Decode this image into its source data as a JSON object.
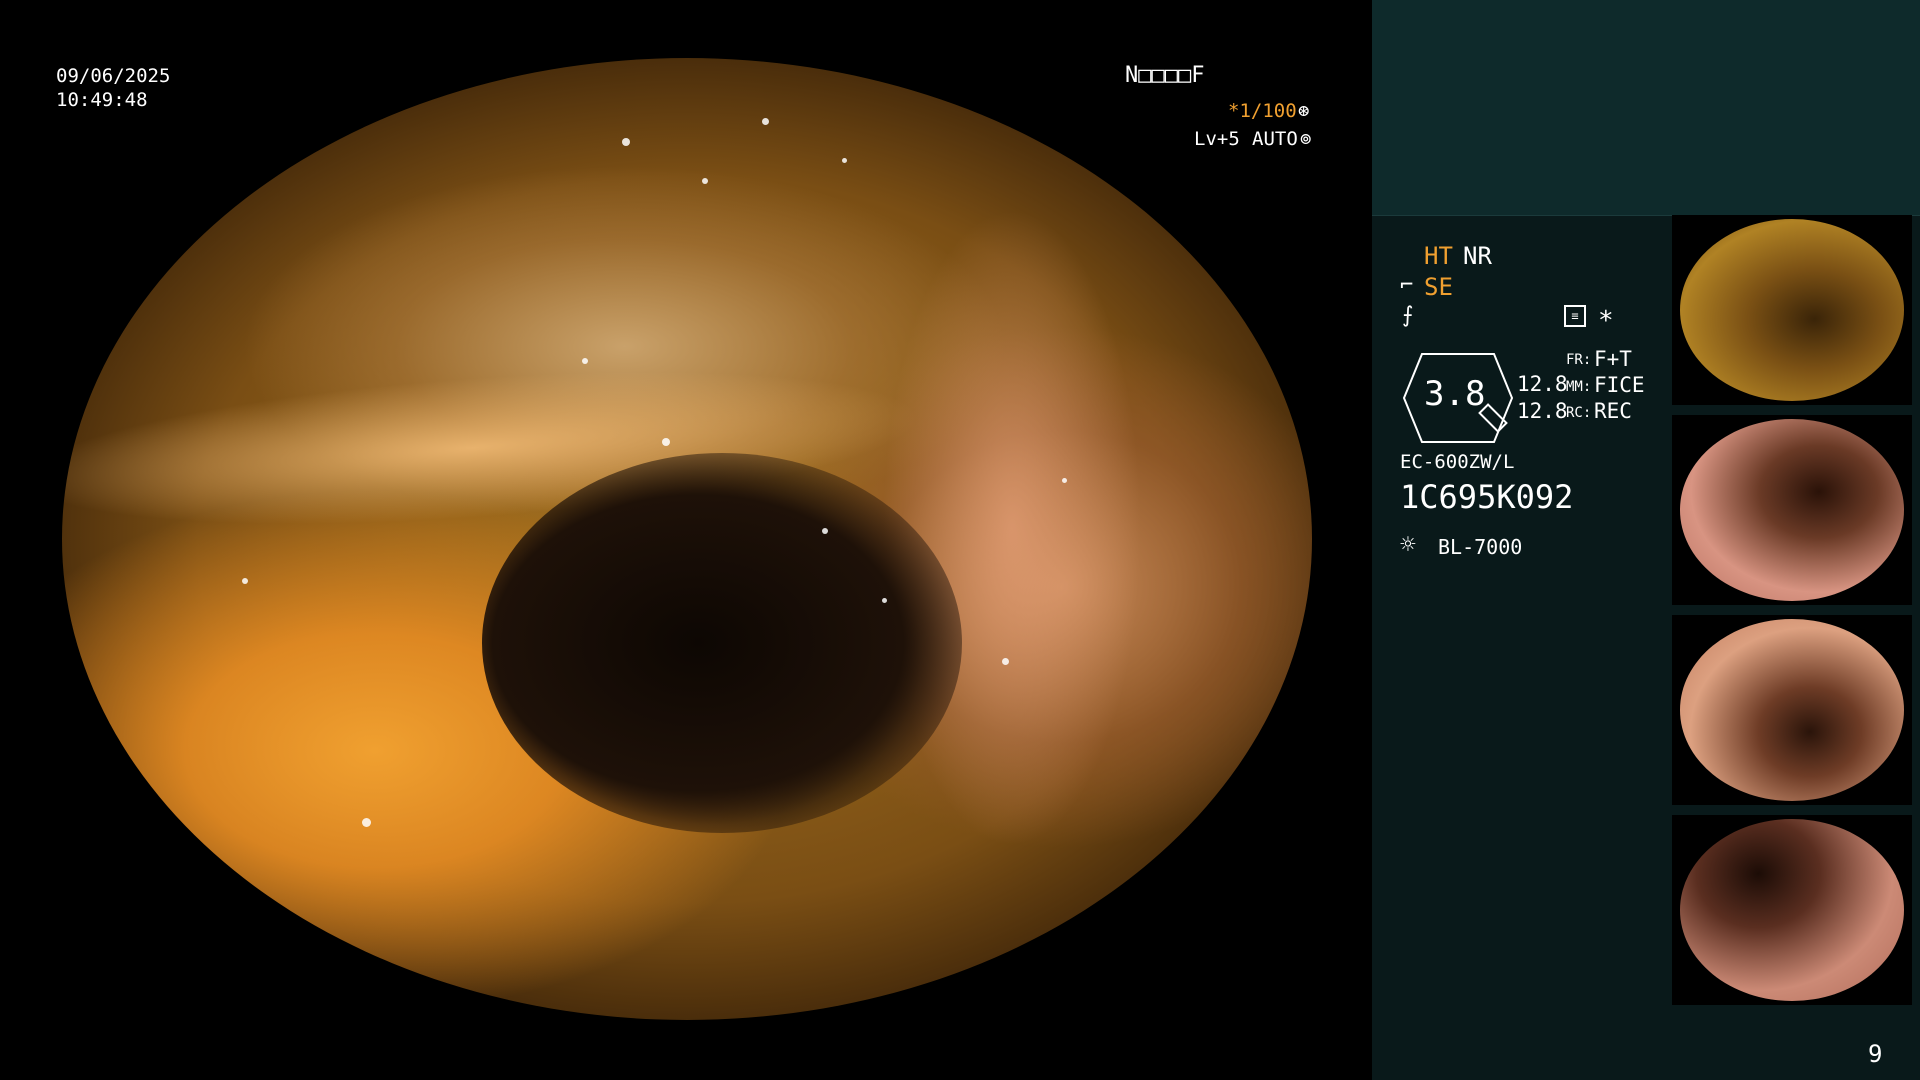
{
  "overlay": {
    "date": "09/06/2025",
    "time": "10:49:48",
    "patient_code": "N□□□□F",
    "shutter": "*1/100",
    "shutter_icon": "aperture-icon",
    "level": "Lv+5",
    "mode": "AUTO",
    "mode_icon": "iris-icon"
  },
  "status": {
    "ht": "HT",
    "nr": "NR",
    "se": "SE",
    "zoom": "3.8",
    "val1": "12.8",
    "val2": "12.8",
    "fr_label": "FR:",
    "fr_value": "F+T",
    "mm_label": "MM:",
    "mm_value": "FICE",
    "rc_label": "RC:",
    "rc_value": "REC",
    "scope_model": "EC-600ZW/L",
    "scope_serial": "1C695K092",
    "light_source": "BL-7000",
    "asterisk": "*"
  },
  "thumbnails": [
    {
      "label": "capture-1",
      "tone": "#a87a1e"
    },
    {
      "label": "capture-2",
      "tone": "#d28c7a"
    },
    {
      "label": "capture-3",
      "tone": "#d89678"
    },
    {
      "label": "capture-4",
      "tone": "#c98070"
    }
  ],
  "page_number": "9",
  "colors": {
    "sidebar_bg": "#09191a",
    "sidebar_top": "#0e2a2b",
    "accent": "#f0a030"
  }
}
